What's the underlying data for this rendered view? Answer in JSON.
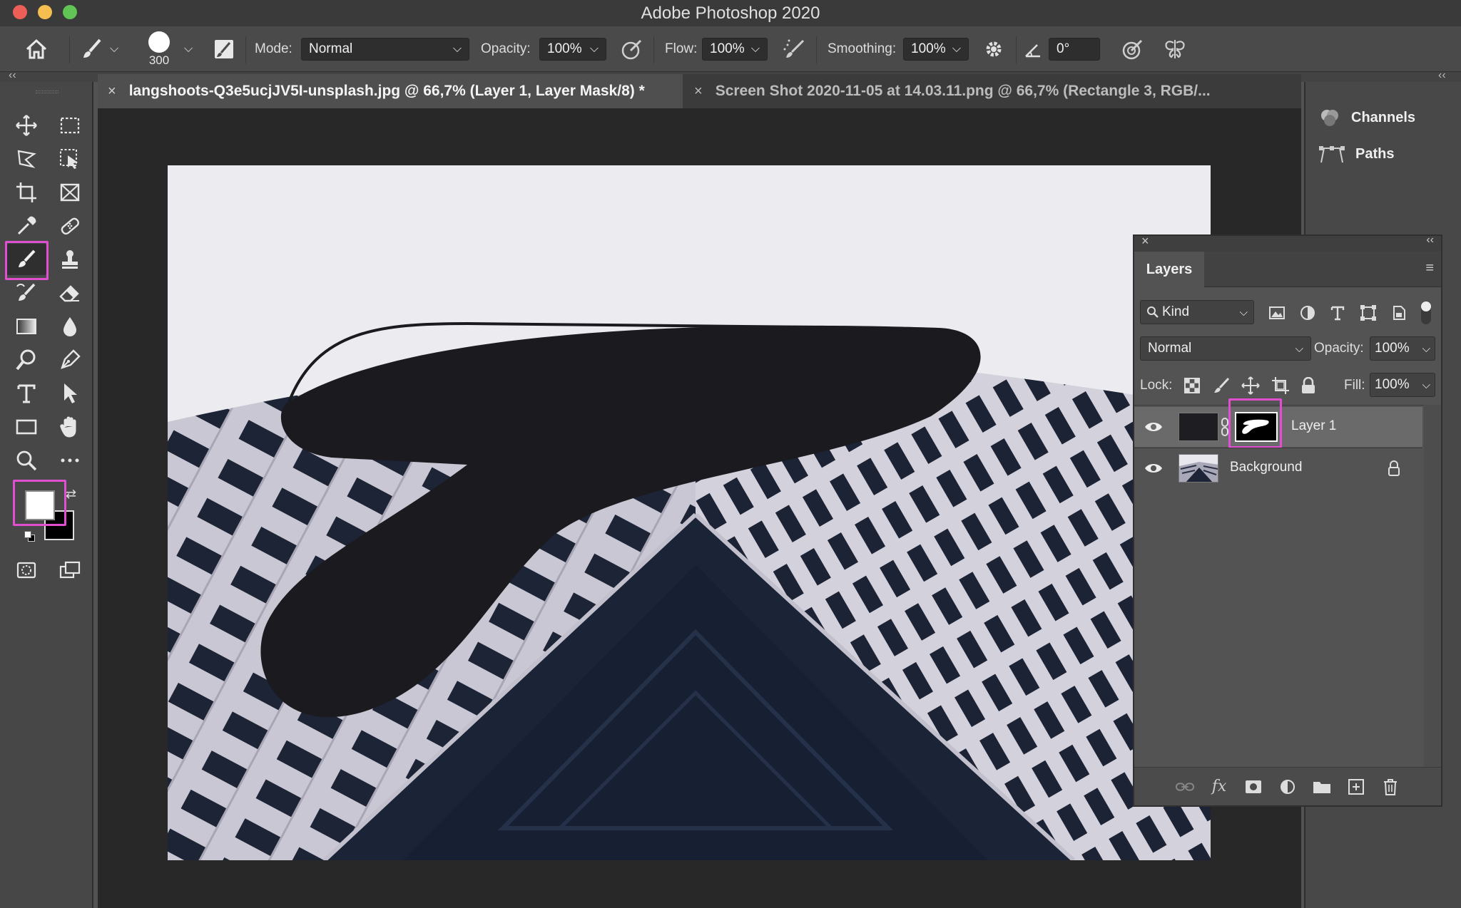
{
  "window": {
    "title": "Adobe Photoshop 2020",
    "colors": {
      "close": "#ec5f57",
      "minimize": "#f4bf4f",
      "maximize": "#61c454",
      "highlight": "#e04fd0"
    }
  },
  "options_bar": {
    "brush_size": "300",
    "mode_label": "Mode:",
    "mode_value": "Normal",
    "opacity_label": "Opacity:",
    "opacity_value": "100%",
    "flow_label": "Flow:",
    "flow_value": "100%",
    "smoothing_label": "Smoothing:",
    "smoothing_value": "100%",
    "angle_value": "0°",
    "icons": [
      "home-icon",
      "brush-preset-icon",
      "brush-settings-icon",
      "pressure-opacity-icon",
      "airbrush-icon",
      "gear-icon",
      "angle-icon",
      "pressure-size-icon",
      "symmetry-icon"
    ]
  },
  "tabs": [
    {
      "label": "langshoots-Q3e5ucjJV5I-unsplash.jpg @ 66,7% (Layer 1, Layer Mask/8) *",
      "active": true
    },
    {
      "label": "Screen Shot 2020-11-05 at 14.03.11.png @ 66,7% (Rectangle 3, RGB/...",
      "active": false
    }
  ],
  "dock": {
    "items": [
      {
        "label": "Channels",
        "icon": "channels-icon"
      },
      {
        "label": "Paths",
        "icon": "paths-icon"
      }
    ]
  },
  "layers_panel": {
    "title": "Layers",
    "filter_label": "Kind",
    "blend_mode": "Normal",
    "opacity_label": "Opacity:",
    "opacity_value": "100%",
    "lock_label": "Lock:",
    "fill_label": "Fill:",
    "fill_value": "100%",
    "layers": [
      {
        "name": "Layer 1",
        "selected": true,
        "visible": true,
        "has_mask": true
      },
      {
        "name": "Background",
        "selected": false,
        "visible": true,
        "locked": true
      }
    ],
    "footer_icons": [
      "link-icon",
      "fx-icon",
      "add-mask-icon",
      "adjustment-icon",
      "folder-icon",
      "new-layer-icon",
      "trash-icon"
    ]
  },
  "colors": {
    "foreground": "#ffffff",
    "background": "#000000"
  }
}
